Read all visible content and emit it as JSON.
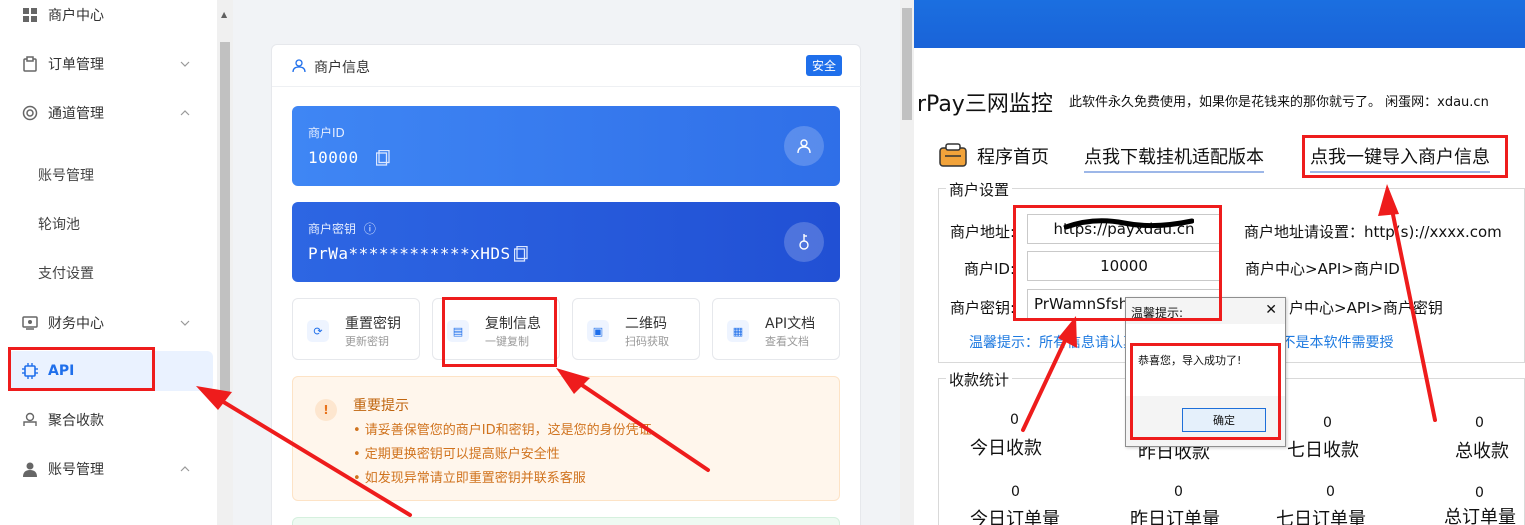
{
  "sidebar": {
    "items": [
      {
        "label": "商户中心"
      },
      {
        "label": "订单管理"
      },
      {
        "label": "通道管理"
      },
      {
        "label": "账号管理"
      },
      {
        "label": "轮询池"
      },
      {
        "label": "支付设置"
      },
      {
        "label": "财务中心"
      },
      {
        "label": "API"
      },
      {
        "label": "聚合收款"
      },
      {
        "label": "账号管理"
      }
    ]
  },
  "merchant_card": {
    "title": "商户信息",
    "badge": "安全",
    "id_label": "商户ID",
    "id_value": "10000",
    "key_label": "商户密钥",
    "key_value": "PrWa************xHDS",
    "actions": [
      {
        "title": "重置密钥",
        "subtitle": "更新密钥"
      },
      {
        "title": "复制信息",
        "subtitle": "一键复制"
      },
      {
        "title": "二维码",
        "subtitle": "扫码获取"
      },
      {
        "title": "API文档",
        "subtitle": "查看文档"
      }
    ],
    "notice": {
      "title": "重要提示",
      "items": [
        "• 请妥善保管您的商户ID和密钥，这是您的身份凭证",
        "• 定期更换密钥可以提高账户安全性",
        "• 如发现异常请立即重置密钥并联系客服"
      ]
    }
  },
  "app": {
    "title": "rPay三网监控",
    "subtitle": "此软件永久免费使用，如果你是花钱来的那你就亏了。 闲蛋网：xdau.cn",
    "nav": {
      "home": "程序首页",
      "download": "点我下载挂机适配版本",
      "import": "点我一键导入商户信息"
    },
    "settings": {
      "group_title": "商户设置",
      "address_label": "商户地址:",
      "address_value": "https://payxdau.cn",
      "address_hint": "商户地址请设置：http(s)://xxxx.com",
      "id_label": "商户ID:",
      "id_value": "10000",
      "id_hint": "商户中心>API>商户ID",
      "key_label": "商户密钥:",
      "key_value": "PrWamnSfsh",
      "key_hint": "户中心>API>商户密钥",
      "warm_tip": "温馨提示：所有信息请认真                        支付网站是否正版！并不是本软件需要授"
    },
    "stats": {
      "group_title": "收款统计",
      "items": [
        {
          "value": "0",
          "label": "今日收款"
        },
        {
          "value": "0",
          "label": "昨日收款"
        },
        {
          "value": "0",
          "label": "七日收款"
        },
        {
          "value": "0",
          "label": "总收款"
        },
        {
          "value": "0",
          "label": "今日订单量"
        },
        {
          "value": "0",
          "label": "昨日订单量"
        },
        {
          "value": "0",
          "label": "七日订单量"
        },
        {
          "value": "0",
          "label": "总订单量"
        }
      ]
    },
    "dialog": {
      "title": "温馨提示:",
      "message": "恭喜您，导入成功了!",
      "ok": "确定"
    }
  },
  "colors": {
    "accent": "#1f6feb",
    "annotation": "#ee1c1c",
    "notice_text": "#d0731e"
  }
}
